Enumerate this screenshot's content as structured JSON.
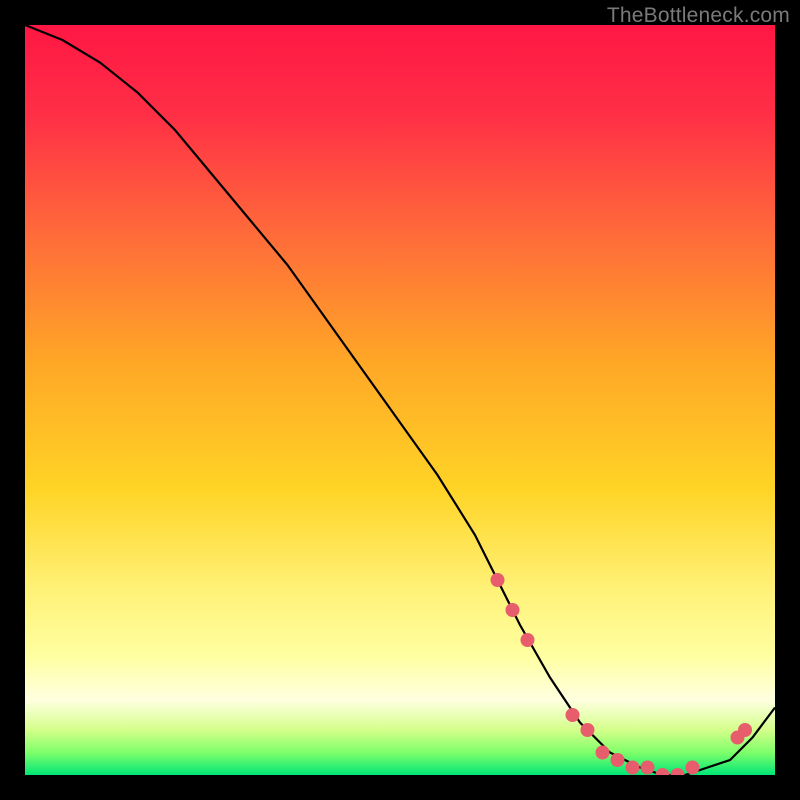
{
  "watermark": "TheBottleneck.com",
  "chart_data": {
    "type": "line",
    "title": "",
    "xlabel": "",
    "ylabel": "",
    "xlim": [
      0,
      100
    ],
    "ylim": [
      0,
      100
    ],
    "background_gradient": {
      "stops": [
        {
          "offset": 0,
          "color": "#ff1744"
        },
        {
          "offset": 12,
          "color": "#ff2f46"
        },
        {
          "offset": 28,
          "color": "#ff6b3a"
        },
        {
          "offset": 45,
          "color": "#ffa726"
        },
        {
          "offset": 62,
          "color": "#ffd426"
        },
        {
          "offset": 75,
          "color": "#fff176"
        },
        {
          "offset": 84,
          "color": "#ffffa0"
        },
        {
          "offset": 90,
          "color": "#ffffe0"
        },
        {
          "offset": 94,
          "color": "#d4ff8a"
        },
        {
          "offset": 97,
          "color": "#7fff6a"
        },
        {
          "offset": 100,
          "color": "#00e676"
        }
      ]
    },
    "series": [
      {
        "name": "bottleneck-curve",
        "x": [
          0,
          5,
          10,
          15,
          20,
          25,
          30,
          35,
          40,
          45,
          50,
          55,
          60,
          63,
          66,
          70,
          74,
          78,
          82,
          85,
          88,
          91,
          94,
          97,
          100
        ],
        "y": [
          100,
          98,
          95,
          91,
          86,
          80,
          74,
          68,
          61,
          54,
          47,
          40,
          32,
          26,
          20,
          13,
          7,
          3,
          1,
          0,
          0,
          1,
          2,
          5,
          9
        ]
      }
    ],
    "markers": {
      "name": "highlight-points",
      "color": "#e85d6c",
      "radius": 7,
      "points": [
        {
          "x": 63,
          "y": 26
        },
        {
          "x": 65,
          "y": 22
        },
        {
          "x": 67,
          "y": 18
        },
        {
          "x": 73,
          "y": 8
        },
        {
          "x": 75,
          "y": 6
        },
        {
          "x": 77,
          "y": 3
        },
        {
          "x": 79,
          "y": 2
        },
        {
          "x": 81,
          "y": 1
        },
        {
          "x": 83,
          "y": 1
        },
        {
          "x": 85,
          "y": 0
        },
        {
          "x": 87,
          "y": 0
        },
        {
          "x": 89,
          "y": 1
        },
        {
          "x": 95,
          "y": 5
        },
        {
          "x": 96,
          "y": 6
        }
      ]
    }
  }
}
